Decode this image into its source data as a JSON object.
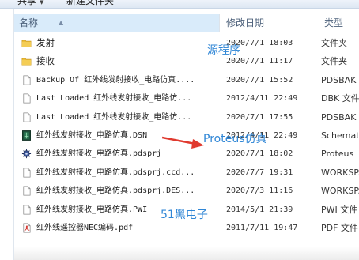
{
  "toolbar": {
    "share": "共享",
    "new_folder": "新建文件夹"
  },
  "columns": {
    "name": "名称",
    "date": "修改日期",
    "type": "类型"
  },
  "files": [
    {
      "name": "发射",
      "date": "2020/7/1 18:03",
      "type": "文件夹",
      "icon": "folder-icon"
    },
    {
      "name": "接收",
      "date": "2020/7/1 11:17",
      "type": "文件夹",
      "icon": "folder-icon"
    },
    {
      "name": "Backup Of 红外线发射接收_电路仿真....",
      "date": "2020/7/1 15:52",
      "type": "PDSBAK 文",
      "icon": "document-icon"
    },
    {
      "name": "Last Loaded 红外线发射接收_电路仿...",
      "date": "2012/4/11 22:49",
      "type": "DBK 文件",
      "icon": "document-icon"
    },
    {
      "name": "Last Loaded 红外线发射接收_电路仿...",
      "date": "2020/7/1 17:55",
      "type": "PDSBAK 文",
      "icon": "document-icon"
    },
    {
      "name": "红外线发射接收_电路仿真.DSN",
      "date": "2012/4/11 22:49",
      "type": "Schemati",
      "icon": "schematic-icon"
    },
    {
      "name": "红外线发射接收_电路仿真.pdsprj",
      "date": "2020/7/1 18:02",
      "type": "Proteus",
      "icon": "proteus-icon"
    },
    {
      "name": "红外线发射接收_电路仿真.pdsprj.ccd...",
      "date": "2020/7/7 19:31",
      "type": "WORKSPAC",
      "icon": "document-icon"
    },
    {
      "name": "红外线发射接收_电路仿真.pdsprj.DES...",
      "date": "2020/7/3 11:16",
      "type": "WORKSPAC",
      "icon": "document-icon"
    },
    {
      "name": "红外线发射接收_电路仿真.PWI",
      "date": "2014/5/1 21:39",
      "type": "PWI 文件",
      "icon": "document-icon"
    },
    {
      "name": "红外线遥控器NEC编码.pdf",
      "date": "2011/7/11 19:47",
      "type": "PDF 文件",
      "icon": "pdf-icon"
    }
  ],
  "annotations": {
    "source": "源程序",
    "proteus": "Proteus仿真",
    "brand": "51黑电子"
  },
  "colors": {
    "annotation": "#2f86d6",
    "arrow": "#e03a2f",
    "folder": "#e8b730",
    "sorted_header": "#d9ebfa"
  }
}
